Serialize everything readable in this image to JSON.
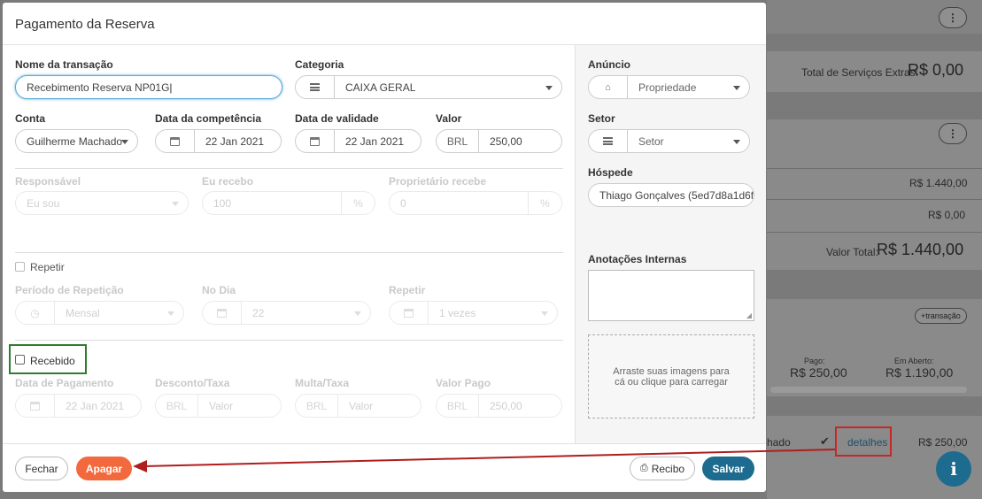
{
  "modal": {
    "title": "Pagamento da Reserva",
    "transaction_name": {
      "label": "Nome da transação",
      "value": "Recebimento Reserva NP01G"
    },
    "category": {
      "label": "Categoria",
      "value": "CAIXA GERAL"
    },
    "account": {
      "label": "Conta",
      "value": "Guilherme Machado"
    },
    "competence_date": {
      "label": "Data da competência",
      "value": "22 Jan 2021"
    },
    "due_date": {
      "label": "Data de validade",
      "value": "22 Jan 2021"
    },
    "amount": {
      "label": "Valor",
      "currency": "BRL",
      "value": "250,00"
    },
    "responsible": {
      "label": "Responsável",
      "value": "Eu sou"
    },
    "i_receive": {
      "label": "Eu recebo",
      "value": "100",
      "unit": "%"
    },
    "owner_receives": {
      "label": "Proprietário recebe",
      "value": "0",
      "unit": "%"
    },
    "repeat": {
      "label": "Repetir"
    },
    "repeat_period": {
      "label": "Período de Repetição",
      "value": "Mensal"
    },
    "on_day": {
      "label": "No Dia",
      "value": "22"
    },
    "repeat_times": {
      "label": "Repetir",
      "value": "1 vezes"
    },
    "received": {
      "label": "Recebido"
    },
    "payment_date": {
      "label": "Data de Pagamento",
      "value": "22 Jan 2021"
    },
    "discount": {
      "label": "Desconto/Taxa",
      "currency": "BRL",
      "placeholder": "Valor"
    },
    "fine": {
      "label": "Multa/Taxa",
      "currency": "BRL",
      "placeholder": "Valor"
    },
    "paid_amount": {
      "label": "Valor Pago",
      "currency": "BRL",
      "value": "250,00"
    },
    "listing": {
      "label": "Anúncio",
      "placeholder": "Propriedade"
    },
    "sector": {
      "label": "Setor",
      "placeholder": "Setor"
    },
    "guest": {
      "label": "Hóspede",
      "value": "Thiago Gonçalves (5ed7d8a1d6f57"
    },
    "notes": {
      "label": "Anotações Internas"
    },
    "dropzone": {
      "text": "Arraste suas imagens para cá ou clique para carregar"
    },
    "buttons": {
      "close": "Fechar",
      "delete": "Apagar",
      "receipt": "Recibo",
      "save": "Salvar"
    }
  },
  "background": {
    "extras_label": "Total de Serviços Extras:",
    "extras_value": "R$ 0,00",
    "line1": "R$ 1.440,00",
    "line2": "R$ 0,00",
    "total_label": "Valor Total:",
    "total_value": "R$ 1.440,00",
    "add_transaction": "+transação",
    "paid_label": "Pago:",
    "paid_value": "R$ 250,00",
    "open_label": "Em Aberto:",
    "open_value": "R$ 1.190,00",
    "row_name": "hado",
    "row_link": "detalhes",
    "row_value": "R$ 250,00"
  },
  "colors": {
    "delete": "#f2693d",
    "save": "#1d6b8f",
    "focus": "#5aa8d6",
    "highlight_green": "#2e7d2e",
    "highlight_red": "#c62828",
    "arrow": "#b01d1d"
  }
}
